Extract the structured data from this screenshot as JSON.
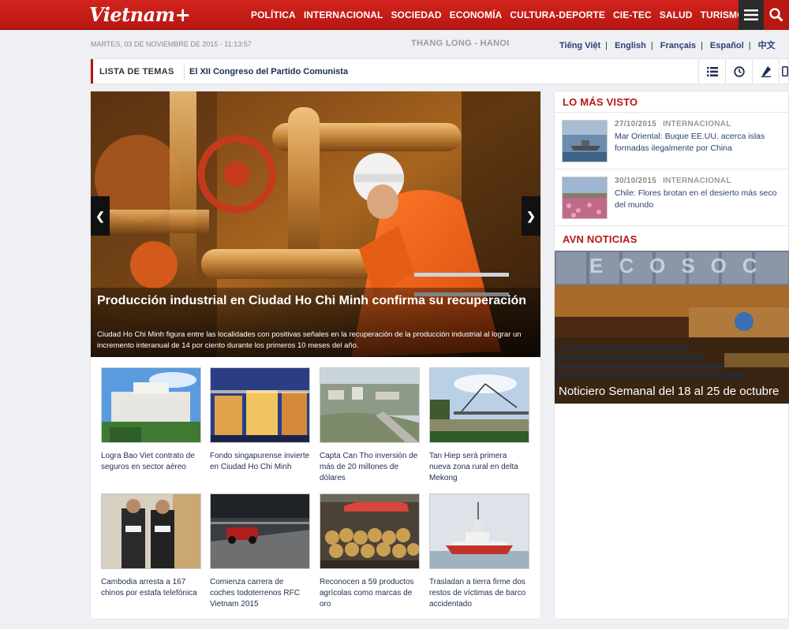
{
  "header": {
    "logo": "Vietnam+",
    "nav": [
      "POLÍTICA",
      "INTERNACIONAL",
      "SOCIEDAD",
      "ECONOMÍA",
      "CULTURA-DEPORTE",
      "CIE-TEC",
      "SALUD",
      "TURISMO"
    ]
  },
  "datebar": {
    "date": "MARTES, 03 DE NOVIEMBRE DE 2015 - 11:13:57",
    "city": "THANG LONG - HANOI",
    "languages": [
      "Tiếng Việt",
      "English",
      "Français",
      "Español",
      "中文"
    ]
  },
  "topics": {
    "label": "LISTA DE TEMAS",
    "link": "El XII Congreso del Partido Comunista"
  },
  "hero": {
    "title": "Producción industrial en Ciudad Ho Chi Minh confirma su recuperación",
    "description": "Ciudad Ho Chi Minh figura entre las localidades con positivas señales en la recuperación de la producción industrial al lograr un incremento interanual de 14 por ciento durante los primeros 10 meses del año."
  },
  "articles": [
    {
      "caption": "Logra Bao Viet contrato de seguros en sector aéreo",
      "image": "building-photo"
    },
    {
      "caption": "Fondo singapurense invierte en Ciudad Ho Chi Minh",
      "image": "night-city-photo"
    },
    {
      "caption": "Capta Can Tho inversión de más de 20 millones de dólares",
      "image": "river-city-photo"
    },
    {
      "caption": "Tan Hiep será primera nueva zona rural en delta Mekong",
      "image": "bridge-photo"
    },
    {
      "caption": "Cambodia arresta a 167 chinos por estafa telefónica",
      "image": "police-photo"
    },
    {
      "caption": "Comienza carrera de coches todoterrenos RFC Vietnam 2015",
      "image": "racing-photo"
    },
    {
      "caption": "Reconocen a 59 productos agrícolas como marcas de oro",
      "image": "fruit-market-photo"
    },
    {
      "caption": "Trasladan a tierra firme dos restos de víctimas de barco accidentado",
      "image": "rescue-ship-photo"
    }
  ],
  "sidebar": {
    "most_viewed_title": "LO MÁS VISTO",
    "most_viewed": [
      {
        "date": "27/10/2015",
        "category": "INTERNACIONAL",
        "title": "Mar Oriental: Buque EE.UU. acerca islas formadas ilegalmente por China"
      },
      {
        "date": "30/10/2015",
        "category": "INTERNACIONAL",
        "title": "Chile: Flores brotan en el desierto más seco del mundo"
      }
    ],
    "avn_title": "AVN NOTICIAS",
    "video_caption": "Noticiero Semanal del 18 al 25 de octubre",
    "video_banner": "ECOSOC"
  }
}
